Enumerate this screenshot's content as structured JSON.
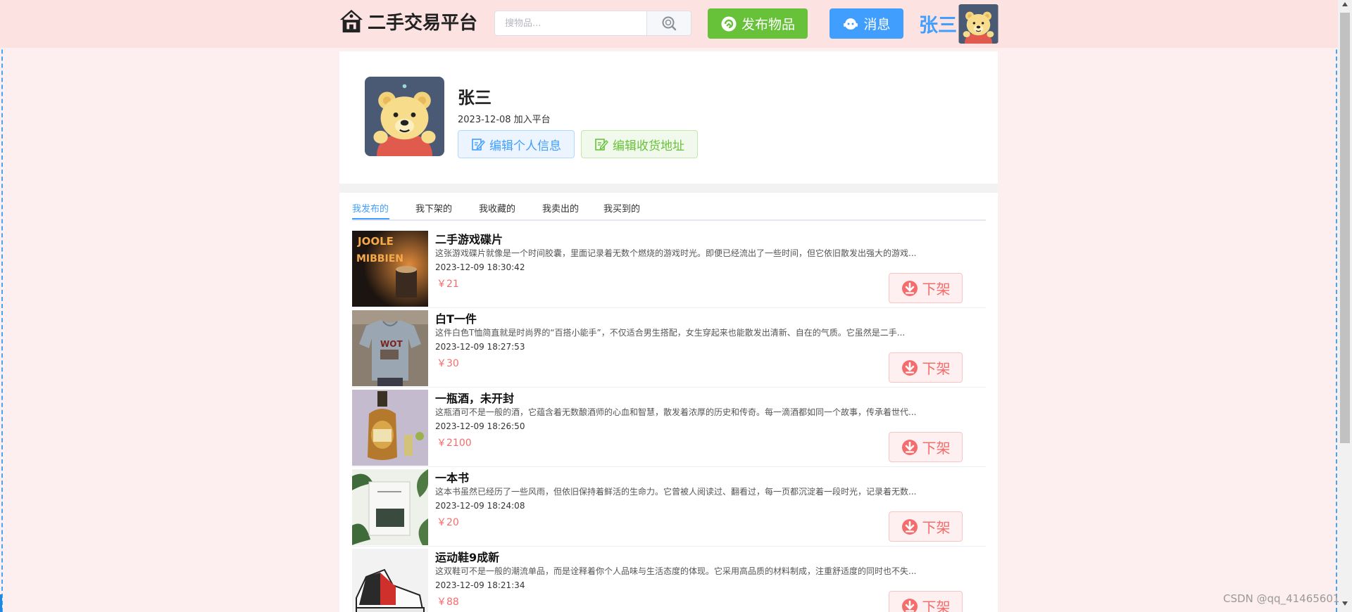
{
  "header": {
    "logo_text": "二手交易平台",
    "search_placeholder": "搜物品...",
    "publish_label": "发布物品",
    "messages_label": "消息",
    "username": "张三"
  },
  "profile": {
    "name": "张三",
    "joined": "2023-12-08 加入平台",
    "edit_info_label": "编辑个人信息",
    "edit_address_label": "编辑收货地址"
  },
  "tabs": [
    {
      "label": "我发布的",
      "active": true
    },
    {
      "label": "我下架的",
      "active": false
    },
    {
      "label": "我收藏的",
      "active": false
    },
    {
      "label": "我卖出的",
      "active": false
    },
    {
      "label": "我买到的",
      "active": false
    }
  ],
  "items": [
    {
      "title": "二手游戏碟片",
      "desc": "这张游戏碟片就像是一个时间胶囊，里面记录着无数个燃烧的游戏时光。即便已经流出了一些时间，但它依旧散发出强大的游戏...",
      "time": "2023-12-09 18:30:42",
      "price": "￥21",
      "action": "下架",
      "image": "game-disc-photo"
    },
    {
      "title": "白T一件",
      "desc": "这件白色T恤简直就是时尚界的“百搭小能手”，不仅适合男生搭配，女生穿起来也能散发出清新、自在的气质。它虽然是二手...",
      "time": "2023-12-09 18:27:53",
      "price": "￥30",
      "action": "下架",
      "image": "tshirt-photo"
    },
    {
      "title": "一瓶酒，未开封",
      "desc": "这瓶酒可不是一般的酒，它蕴含着无数酿酒师的心血和智慧，散发着浓厚的历史和传奇。每一滴酒都如同一个故事，传承着世代...",
      "time": "2023-12-09 18:26:50",
      "price": "￥2100",
      "action": "下架",
      "image": "wine-bottle-photo"
    },
    {
      "title": "一本书",
      "desc": "这本书虽然已经历了一些风雨，但依旧保持着鲜活的生命力。它曾被人阅读过、翻看过，每一页都沉淀着一段时光，记录着无数...",
      "time": "2023-12-09 18:24:08",
      "price": "￥20",
      "action": "下架",
      "image": "book-photo"
    },
    {
      "title": "运动鞋9成新",
      "desc": "这双鞋可不是一般的潮流单品，而是诠释着你个人品味与生活态度的体现。它采用高品质的材料制成，注重舒适度的同时也不失...",
      "time": "2023-12-09 18:21:34",
      "price": "￥88",
      "action": "下架",
      "image": "sneaker-photo"
    }
  ],
  "watermark": "CSDN @qq_41465601",
  "colors": {
    "primary": "#409eff",
    "success": "#67c23a",
    "danger": "#f56c6c",
    "header_bg": "#fde2e2",
    "page_bg": "#fdeef0"
  }
}
